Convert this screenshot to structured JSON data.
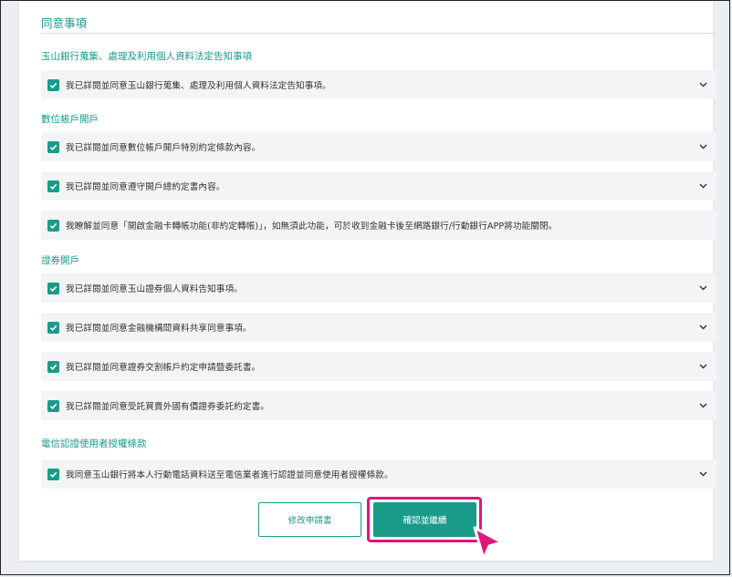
{
  "section": {
    "title": "同意事項"
  },
  "groups": [
    {
      "title": "玉山銀行蒐集、處理及利用個人資料法定告知事項",
      "items": [
        "我已詳閱並同意玉山銀行蒐集、處理及利用個人資料法定告知事項。"
      ]
    },
    {
      "title": "數位帳戶開戶",
      "items": [
        "我已詳閱並同意數位帳戶開戶特別約定條款內容。",
        "我已詳閱並同意遵守開戶總約定書內容。",
        "我瞭解並同意「開啟金融卡轉帳功能(非約定轉帳)」，如無須此功能，可於收到金融卡後至網路銀行/行動銀行APP將功能關閉。"
      ]
    },
    {
      "title": "證券開戶",
      "items": [
        "我已詳閱並同意玉山證券個人資料告知事項。",
        "我已詳閱並同意金融機構間資料共享同意事項。",
        "我已詳閱並同意證券交割帳戶約定申請暨委託書。",
        "我已詳閱並同意受託買賣外國有價證券委託約定書。"
      ]
    },
    {
      "title": "電信認證使用者授權條款",
      "items": [
        "我同意玉山銀行將本人行動電話資料送至電信業者進行認證並同意使用者授權條款。"
      ]
    }
  ],
  "buttons": {
    "edit": "修改申請書",
    "confirm": "確認並繼續"
  },
  "colors": {
    "accent": "#1a9a8a",
    "highlight": "#e0177a"
  },
  "icons": {
    "checkbox": "check-icon",
    "expand": "chevron-down-icon",
    "pointer": "cursor-arrow-icon"
  }
}
